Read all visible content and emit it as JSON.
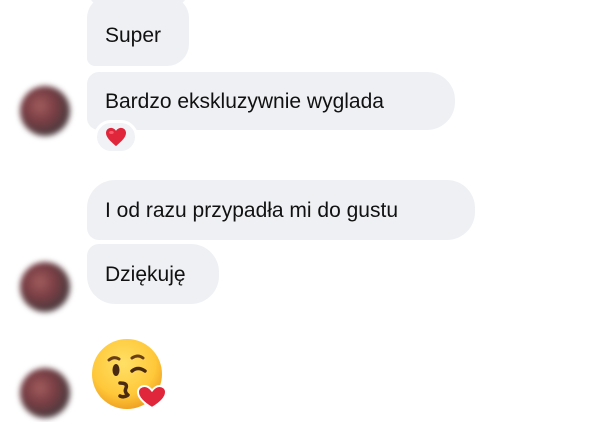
{
  "messages": [
    {
      "text": "Super"
    },
    {
      "text": "Bardzo ekskluzywnie wyglada",
      "reaction": "red-heart"
    },
    {
      "text": "I od razu przypadła mi do gustu"
    },
    {
      "text": "Dziękuję"
    },
    {
      "emoji": "face-blowing-a-kiss"
    }
  ],
  "colors": {
    "bubble": "#eef0f3",
    "text": "#111111",
    "heart": "#e0263b",
    "emoji_face": "#ffc83a"
  }
}
